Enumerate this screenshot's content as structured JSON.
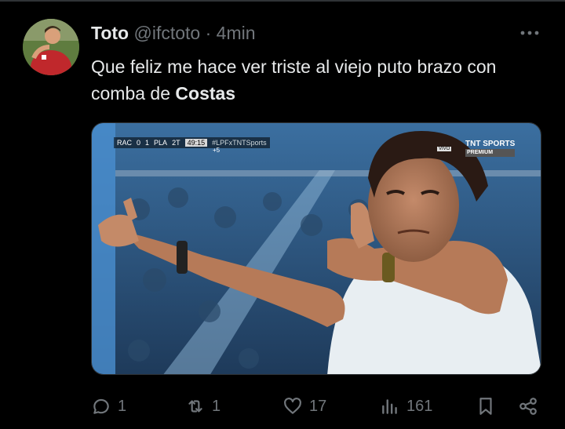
{
  "tweet": {
    "author_name": "Toto",
    "handle": "@ifctoto",
    "separator": "·",
    "time": "4min",
    "text_part1": "Que feliz me hace ver triste al viejo puto brazo con comba de ",
    "text_bold": "Costas"
  },
  "media": {
    "scorebar": {
      "home": "RAC",
      "home_score": "0",
      "away_score": "1",
      "away": "PLA",
      "period": "2T",
      "clock": "49:15",
      "hashtag": "#LPFxTNTSports",
      "added": "+5"
    },
    "live_label": "VIVO",
    "channel_top": "TNT SPORTS",
    "channel_bottom": "PREMIUM"
  },
  "actions": {
    "replies": "1",
    "reposts": "1",
    "likes": "17",
    "views": "161"
  },
  "colors": {
    "background": "#000000",
    "text": "#e7e9ea",
    "muted": "#71767b",
    "border": "#2f3336"
  }
}
